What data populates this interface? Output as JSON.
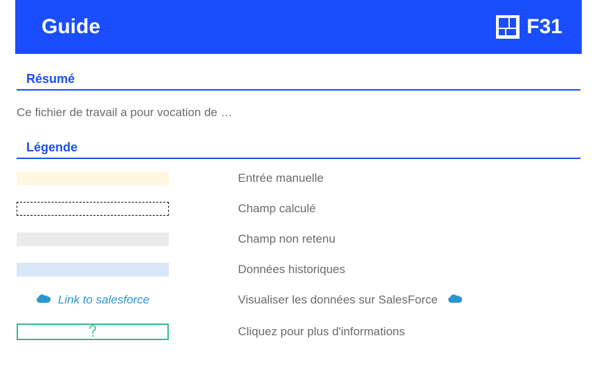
{
  "header": {
    "title": "Guide",
    "logo_text": "F31"
  },
  "sections": {
    "summary_heading": "Résumé",
    "intro_text": "Ce fichier de travail a pour vocation de …",
    "legend_heading": "Légende"
  },
  "legend": {
    "items": [
      {
        "label": "Entrée manuelle"
      },
      {
        "label": "Champ calculé"
      },
      {
        "label": "Champ non retenu"
      },
      {
        "label": "Données historiques"
      },
      {
        "label": "Visualiser les données sur SalesForce"
      },
      {
        "label": "Cliquez pour plus d'informations"
      }
    ],
    "salesforce_link_text": "Link to salesforce",
    "help_symbol": "?"
  },
  "icons": {
    "cloud": "cloud-icon",
    "help": "help-icon",
    "logo": "logo-icon"
  },
  "colors": {
    "brand": "#1a4dff",
    "manual_bg": "#fff7e0",
    "nonret_bg": "#ebebeb",
    "hist_bg": "#d9e6f7",
    "help_border": "#35b88d",
    "cloud": "#2b96cf"
  }
}
